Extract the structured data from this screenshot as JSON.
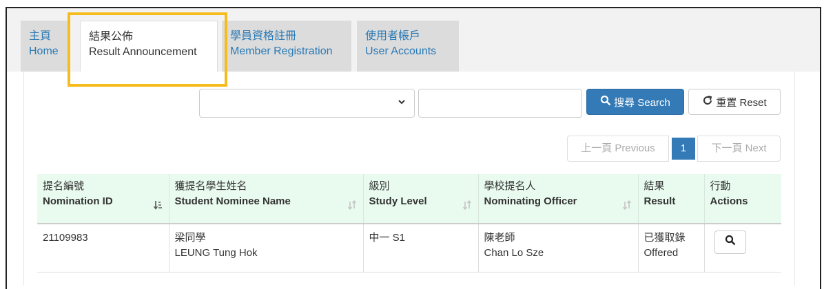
{
  "tabs": [
    {
      "zh": "主頁",
      "en": "Home",
      "icon": "none"
    },
    {
      "zh": "結果公佈",
      "en": "Result Announcement"
    },
    {
      "zh": "學員資格註冊",
      "en": "Member Registration"
    },
    {
      "zh": "使用者帳戶",
      "en": "User Accounts"
    }
  ],
  "search": {
    "select_value": "",
    "input_value": "",
    "search_label": "搜尋 Search",
    "reset_label": "重置 Reset"
  },
  "pager": {
    "prev": "上一頁 Previous",
    "current": "1",
    "next": "下一頁 Next"
  },
  "table": {
    "headers": [
      {
        "zh": "提名編號",
        "en": "Nomination ID"
      },
      {
        "zh": "獲提名學生姓名",
        "en": "Student Nominee Name"
      },
      {
        "zh": "級別",
        "en": "Study Level"
      },
      {
        "zh": "學校提名人",
        "en": "Nominating Officer"
      },
      {
        "zh": "結果",
        "en": "Result"
      },
      {
        "zh": "行動",
        "en": "Actions"
      }
    ],
    "rows": [
      {
        "nomination_id": "21109983",
        "student_zh": "梁同學",
        "student_en": "LEUNG Tung Hok",
        "study_level": "中一 S1",
        "officer_zh": "陳老師",
        "officer_en": "Chan Lo Sze",
        "result_zh": "已獲取錄",
        "result_en": "Offered"
      }
    ]
  },
  "colors": {
    "accent": "#337ab7",
    "highlight": "#f6bc1c",
    "header_bg": "#e9fbef"
  }
}
